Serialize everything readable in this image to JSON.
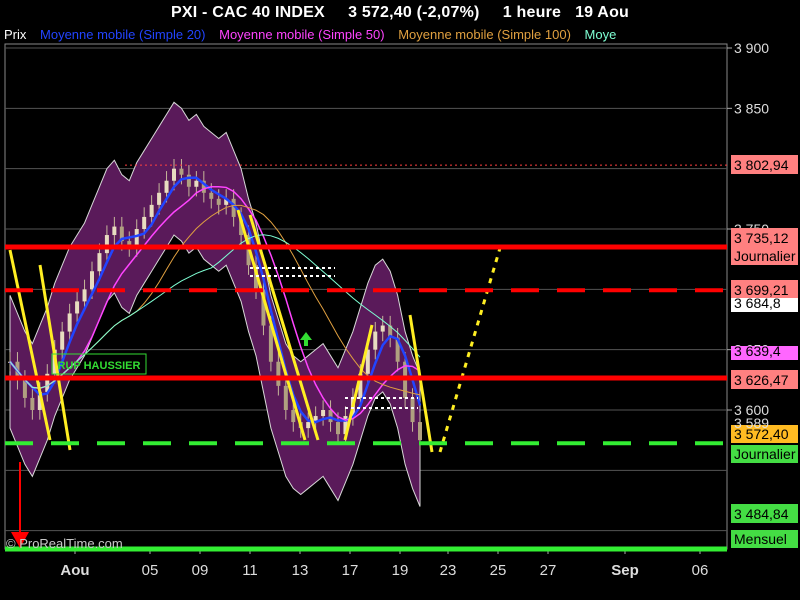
{
  "header": {
    "title": "PXI - CAC 40 INDEX",
    "price": "3 572,40 (-2,07%)",
    "timeframe": "1 heure",
    "date": "19 Aou"
  },
  "legend": [
    {
      "label": "Prix",
      "color": "#ffffff"
    },
    {
      "label": "Moyenne mobile (Simple 20)",
      "color": "#2244ff"
    },
    {
      "label": "Moyenne mobile (Simple 50)",
      "color": "#ff44ff"
    },
    {
      "label": "Moyenne mobile (Simple 100)",
      "color": "#e0a040"
    },
    {
      "label": "Moye",
      "color": "#7fffd4"
    }
  ],
  "watermark": "© ProRealTime.com",
  "annotation": "RUP HAUSSIER",
  "chart_data": {
    "type": "candlestick",
    "y_axis": {
      "ticks": [
        "3 900",
        "3 850",
        "3 750",
        "3 650",
        "3 600",
        "3 589"
      ]
    },
    "x_axis": {
      "ticks": [
        "Aou",
        "05",
        "09",
        "11",
        "13",
        "17",
        "19",
        "23",
        "25",
        "27",
        "Sep",
        "06"
      ]
    },
    "price_tags": [
      {
        "text": "3 802,94",
        "bg": "#ff8080",
        "fg": "#000000"
      },
      {
        "text": "3 735,12",
        "bg": "#ff8080",
        "fg": "#000000"
      },
      {
        "text": "Journalier",
        "bg": "#ff8080",
        "fg": "#000000"
      },
      {
        "text": "3 699,21",
        "bg": "#ff8080",
        "fg": "#000000"
      },
      {
        "text": "3 684,8",
        "bg": "#ffffff",
        "fg": "#000000"
      },
      {
        "text": "3 639,4",
        "bg": "#ff66ff",
        "fg": "#000000"
      },
      {
        "text": "3 626,47",
        "bg": "#ff8080",
        "fg": "#000000"
      },
      {
        "text": "3 572,40",
        "bg": "#ffbb22",
        "fg": "#000000"
      },
      {
        "text": "Journalier",
        "bg": "#44dd44",
        "fg": "#000000"
      },
      {
        "text": "3 484,84",
        "bg": "#44dd44",
        "fg": "#000000"
      },
      {
        "text": "Mensuel",
        "bg": "#44dd44",
        "fg": "#000000"
      }
    ],
    "levels": [
      {
        "value": 3802.94,
        "style": "dotted",
        "color": "#ff4040"
      },
      {
        "value": 3735.12,
        "style": "solid",
        "color": "#ff0000",
        "label": "Journalier"
      },
      {
        "value": 3699.21,
        "style": "dashed",
        "color": "#ff0000"
      },
      {
        "value": 3626.47,
        "style": "solid",
        "color": "#ff0000"
      },
      {
        "value": 3572.4,
        "style": "dashed",
        "color": "#33ee33"
      },
      {
        "value": 3484.84,
        "style": "solid",
        "color": "#33ee33",
        "label": "Mensuel"
      }
    ],
    "closes": [
      3640,
      3625,
      3610,
      3600,
      3615,
      3630,
      3650,
      3665,
      3680,
      3690,
      3700,
      3715,
      3730,
      3745,
      3752,
      3740,
      3735,
      3750,
      3760,
      3770,
      3780,
      3790,
      3800,
      3795,
      3785,
      3790,
      3780,
      3775,
      3770,
      3775,
      3760,
      3745,
      3720,
      3700,
      3670,
      3640,
      3620,
      3600,
      3590,
      3585,
      3590,
      3595,
      3600,
      3590,
      3580,
      3595,
      3610,
      3630,
      3650,
      3665,
      3670,
      3660,
      3640,
      3610,
      3590,
      3575
    ]
  }
}
